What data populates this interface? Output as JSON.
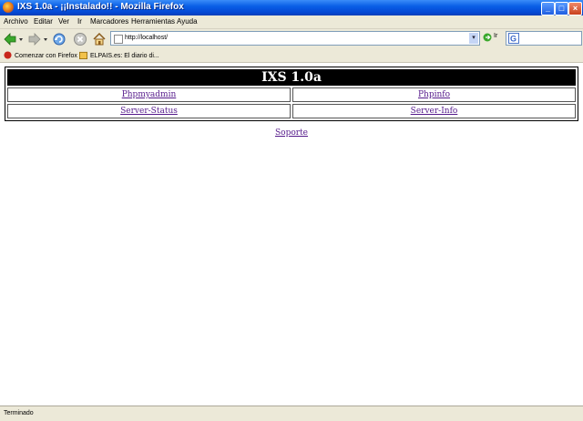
{
  "window": {
    "title": "IXS 1.0a - ¡¡Instalado!! - Mozilla Firefox",
    "minimize": "_",
    "maximize": "□",
    "close": "×"
  },
  "menu": {
    "items": [
      "Archivo",
      "Editar",
      "Ver",
      "Ir",
      "Marcadores",
      "Herramientas",
      "Ayuda"
    ]
  },
  "nav": {
    "url": "http://localhost/",
    "go_label": "Ir",
    "dropdown_glyph": "▾"
  },
  "bookmarks": {
    "items": [
      "Comenzar con Firefox",
      "ELPAIS.es: El diario di..."
    ]
  },
  "page": {
    "heading": "IXS 1.0a",
    "links": [
      [
        "Phpmyadmin",
        "Phpinfo"
      ],
      [
        "Server-Status",
        "Server-Info"
      ]
    ],
    "support": "Soporte"
  },
  "status": {
    "text": "Terminado"
  },
  "colors": {
    "titlebar": "#0a5fe6",
    "chrome": "#ece9d8",
    "link": "#551a8b",
    "heading_bg": "#000000"
  }
}
